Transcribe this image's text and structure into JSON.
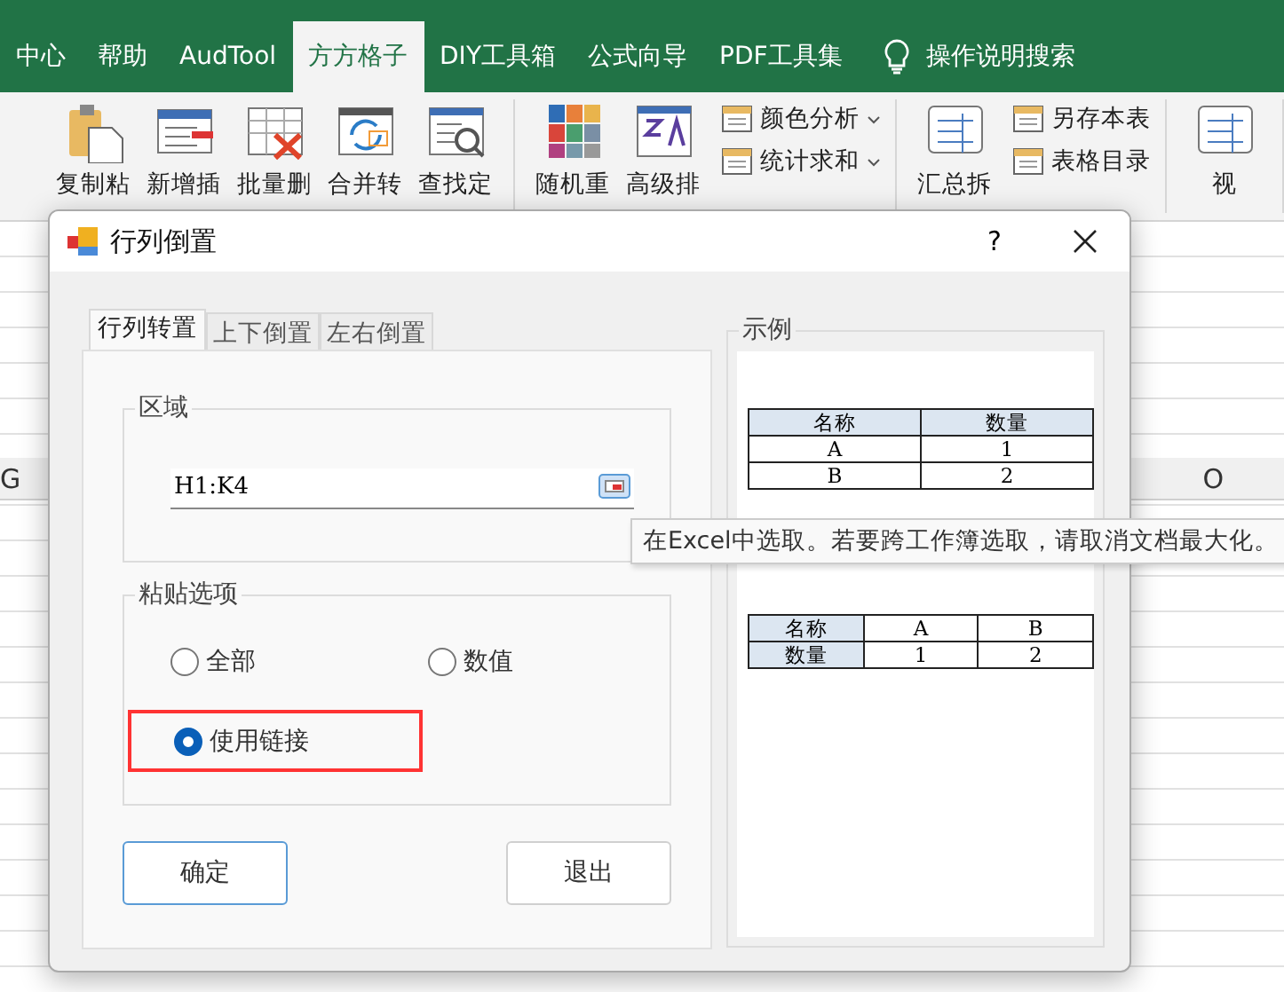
{
  "ribbon_tabs": [
    {
      "label": "中心",
      "selected": false
    },
    {
      "label": "帮助",
      "selected": false
    },
    {
      "label": "AudTool",
      "selected": false
    },
    {
      "label": "方方格子",
      "selected": true
    },
    {
      "label": "DIY工具箱",
      "selected": false
    },
    {
      "label": "公式向导",
      "selected": false
    },
    {
      "label": "PDF工具集",
      "selected": false
    }
  ],
  "search": {
    "label": "操作说明搜索"
  },
  "ribbon_groups": [
    {
      "items": [
        {
          "kind": "large",
          "label": "复制粘"
        },
        {
          "kind": "large",
          "label": "新增插"
        },
        {
          "kind": "large",
          "label": "批量删"
        },
        {
          "kind": "large",
          "label": "合并转"
        },
        {
          "kind": "large",
          "label": "查找定"
        }
      ]
    },
    {
      "items": [
        {
          "kind": "large",
          "label": "随机重"
        },
        {
          "kind": "large",
          "label": "高级排"
        },
        {
          "kind": "small",
          "label": "颜色分析",
          "dropdown": true
        },
        {
          "kind": "small",
          "label": "统计求和",
          "dropdown": true
        }
      ]
    },
    {
      "items": [
        {
          "kind": "large",
          "label": "汇总拆"
        },
        {
          "kind": "small",
          "label": "另存本表",
          "dropdown": false
        },
        {
          "kind": "small",
          "label": "表格目录",
          "dropdown": false
        }
      ]
    },
    {
      "items": [
        {
          "kind": "large",
          "label": "视"
        }
      ]
    }
  ],
  "column_headers": [
    {
      "label": "G"
    },
    {
      "label": "O"
    }
  ],
  "dialog": {
    "title": "行列倒置",
    "help": "?",
    "tabs": [
      {
        "label": "行列转置",
        "selected": true
      },
      {
        "label": "上下倒置",
        "selected": false
      },
      {
        "label": "左右倒置",
        "selected": false
      }
    ],
    "range_group": {
      "title": "区域",
      "value": "H1:K4"
    },
    "paste_group": {
      "title": "粘贴选项",
      "options": [
        {
          "label": "全部",
          "selected": false,
          "highlighted": false
        },
        {
          "label": "数值",
          "selected": false,
          "highlighted": false
        },
        {
          "label": "使用链接",
          "selected": true,
          "highlighted": true
        }
      ]
    },
    "buttons": [
      {
        "label": "确定",
        "default": true
      },
      {
        "label": "退出",
        "default": false
      }
    ],
    "example": {
      "title": "示例",
      "tables": [
        {
          "rows": [
            [
              {
                "text": "名称",
                "header": true
              },
              {
                "text": "数量",
                "header": true
              }
            ],
            [
              {
                "text": "A",
                "header": false
              },
              {
                "text": "1",
                "header": false
              }
            ],
            [
              {
                "text": "B",
                "header": false
              },
              {
                "text": "2",
                "header": false
              }
            ]
          ]
        },
        {
          "rows": [
            [
              {
                "text": "名称",
                "header": true
              },
              {
                "text": "A",
                "header": false
              },
              {
                "text": "B",
                "header": false
              }
            ],
            [
              {
                "text": "数量",
                "header": true
              },
              {
                "text": "1",
                "header": false
              },
              {
                "text": "2",
                "header": false
              }
            ]
          ]
        }
      ]
    }
  },
  "tooltip": "在Excel中选取。若要跨工作簿选取，请取消文档最大化。"
}
